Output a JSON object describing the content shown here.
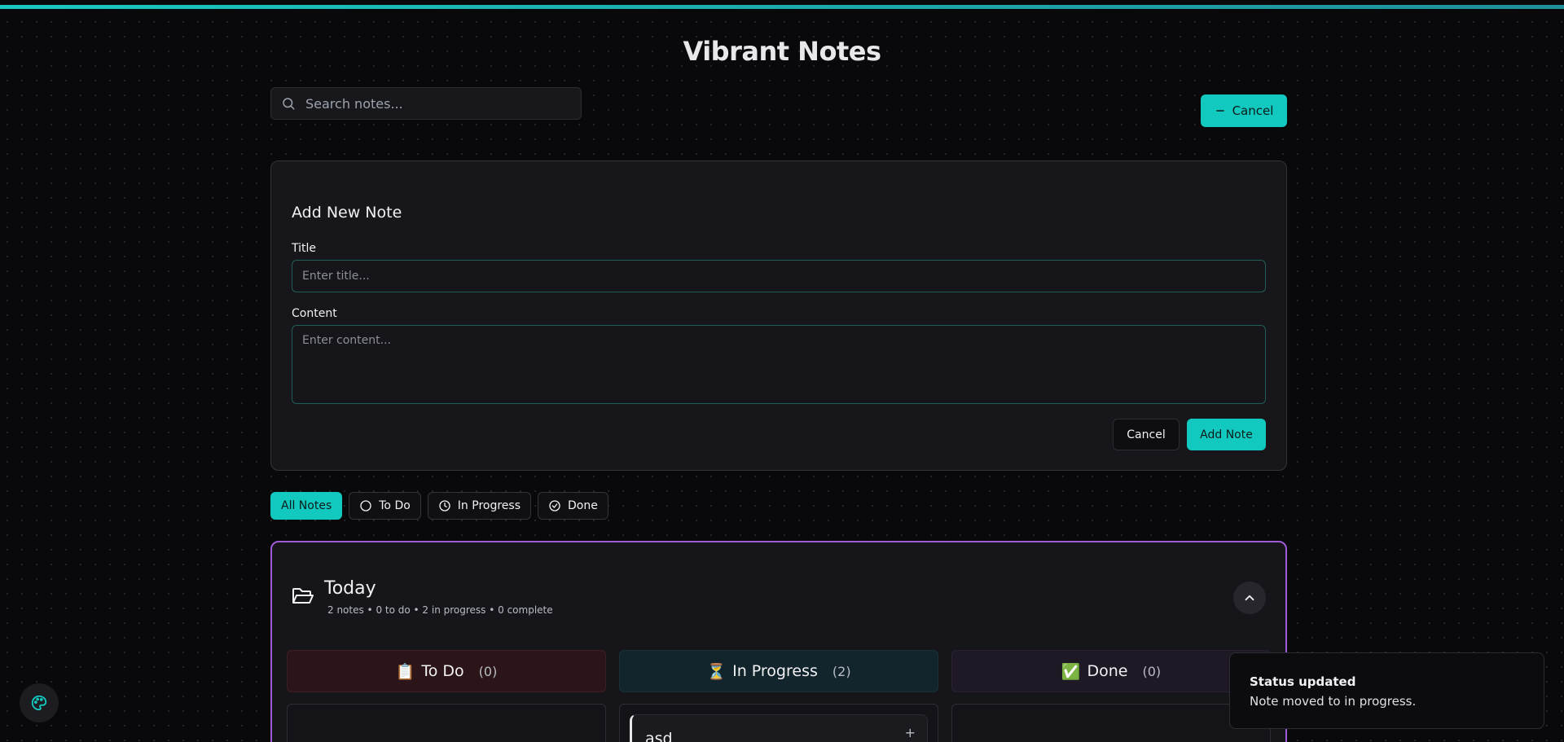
{
  "app": {
    "title": "Vibrant Notes"
  },
  "search": {
    "placeholder": "Search notes..."
  },
  "header": {
    "toggle_form_label": "Cancel"
  },
  "form": {
    "heading": "Add New Note",
    "title_label": "Title",
    "title_placeholder": "Enter title...",
    "content_label": "Content",
    "content_placeholder": "Enter content...",
    "cancel_label": "Cancel",
    "submit_label": "Add Note"
  },
  "filters": [
    {
      "label": "All Notes",
      "icon": "none",
      "active": true
    },
    {
      "label": "To Do",
      "icon": "circle-icon",
      "active": false
    },
    {
      "label": "In Progress",
      "icon": "clock-icon",
      "active": false
    },
    {
      "label": "Done",
      "icon": "check-circle-icon",
      "active": false
    }
  ],
  "group": {
    "title": "Today",
    "meta": "2 notes • 0 to do • 2 in progress • 0 complete",
    "columns": [
      {
        "emoji": "📋",
        "label": "To Do",
        "count": "(0)"
      },
      {
        "emoji": "⏳",
        "label": "In Progress",
        "count": "(2)"
      },
      {
        "emoji": "✅",
        "label": "Done",
        "count": "(0)"
      }
    ],
    "in_progress_notes": [
      {
        "title": "asd"
      }
    ]
  },
  "toast": {
    "title": "Status updated",
    "description": "Note moved to in progress."
  },
  "colors": {
    "accent": "#12c9bf",
    "group_border": "#9d5bd8",
    "background": "#09090b"
  }
}
